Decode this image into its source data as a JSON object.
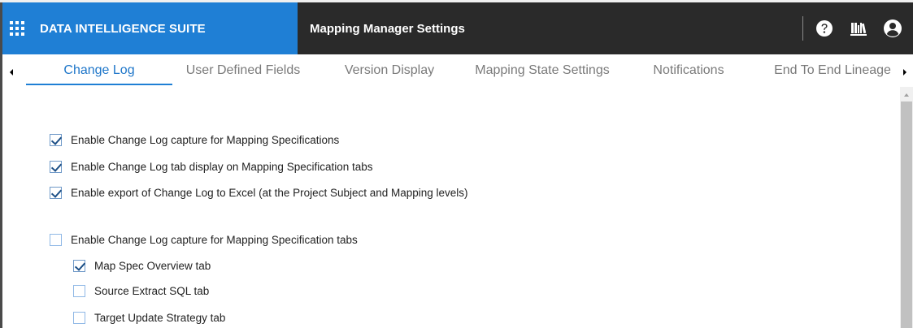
{
  "header": {
    "apps_icon": "apps-grid-icon",
    "brand": "DATA INTELLIGENCE SUITE",
    "page_title": "Mapping Manager Settings",
    "icons": [
      "help-icon",
      "library-icon",
      "user-account-icon"
    ]
  },
  "colors": {
    "brand_bar": "#1f7fd5",
    "title_bar": "#2a2a2a",
    "active_tab": "#1e76c9",
    "inactive_tab": "#7a7a7a",
    "checkbox_border": "#8fb8e6",
    "checkmark": "#1c4f86"
  },
  "tabs": [
    {
      "label": "Change Log",
      "active": true
    },
    {
      "label": "User Defined Fields",
      "active": false
    },
    {
      "label": "Version Display",
      "active": false
    },
    {
      "label": "Mapping State Settings",
      "active": false
    },
    {
      "label": "Notifications",
      "active": false
    },
    {
      "label": "End To End Lineage",
      "active": false
    }
  ],
  "options": [
    {
      "label": "Enable Change Log capture for Mapping Specifications",
      "checked": true
    },
    {
      "label": "Enable Change Log tab display on Mapping Specification tabs",
      "checked": true
    },
    {
      "label": "Enable export of Change Log to Excel (at the Project Subject and Mapping levels)",
      "checked": true
    },
    {
      "label": "Enable Change Log capture for Mapping Specification tabs",
      "checked": false
    }
  ],
  "sub_options": [
    {
      "label": "Map Spec Overview tab",
      "checked": true
    },
    {
      "label": "Source Extract SQL tab",
      "checked": false
    },
    {
      "label": "Target Update Strategy tab",
      "checked": false
    }
  ]
}
